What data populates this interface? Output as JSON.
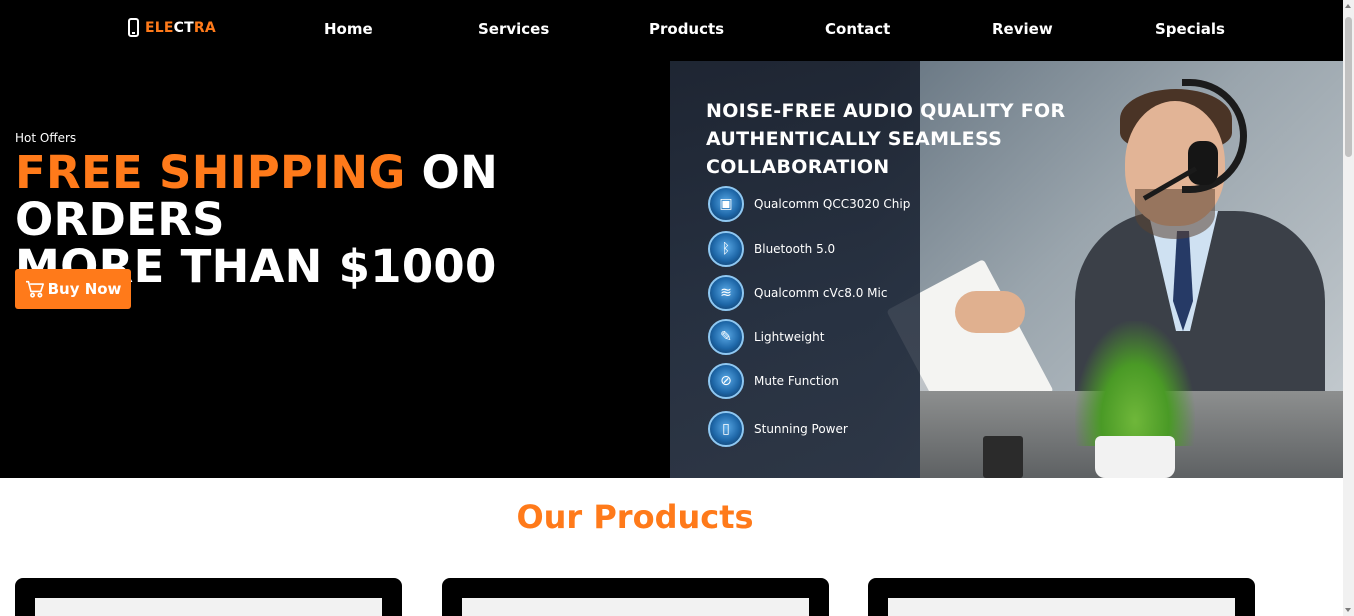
{
  "brand": {
    "part1": "ELE",
    "part2": "CT",
    "part3": "RA",
    "icon": "smartphone-icon"
  },
  "nav": {
    "links": [
      "Home",
      "Services",
      "Products",
      "Contact",
      "Review",
      "Specials"
    ]
  },
  "hero": {
    "eyebrow": "Hot Offers",
    "title_highlight": "FREE SHIPPING",
    "title_rest_line1": " ON ORDERS",
    "title_line2": "MORE THAN $1000",
    "cta_label": "Buy Now",
    "cta_icon": "cart-icon"
  },
  "promo": {
    "heading": "NOISE-FREE AUDIO QUALITY FOR AUTHENTICALLY SEAMLESS COLLABORATION",
    "features": [
      {
        "label": "Qualcomm QCC3020 Chip",
        "icon": "chip-icon"
      },
      {
        "label": "Bluetooth 5.0",
        "icon": "bluetooth-icon"
      },
      {
        "label": "Qualcomm cVc8.0 Mic",
        "icon": "soundwave-icon"
      },
      {
        "label": "Lightweight",
        "icon": "feather-icon"
      },
      {
        "label": "Mute Function",
        "icon": "mute-mic-icon"
      },
      {
        "label": "Stunning Power",
        "icon": "battery-icon"
      }
    ]
  },
  "products": {
    "title": "Our Products"
  },
  "colors": {
    "accent": "#ff7a1a",
    "nav_bg": "#000000",
    "hero_bg": "#000000"
  }
}
